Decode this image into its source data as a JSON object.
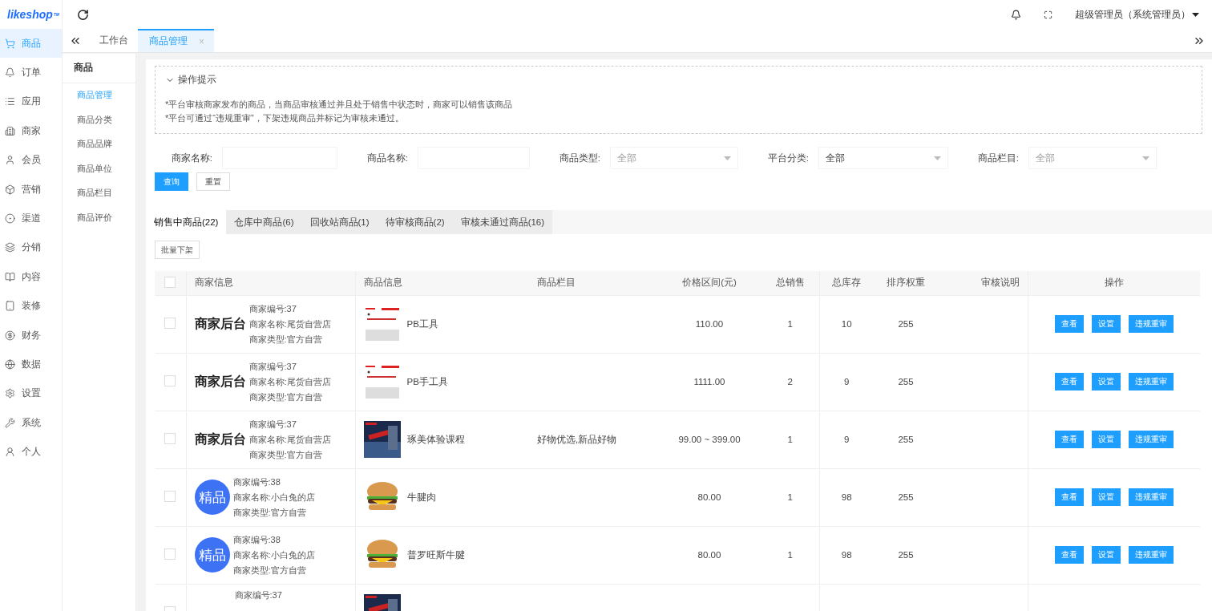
{
  "logo": {
    "text": "likeshop",
    "mark": "TM"
  },
  "nav": [
    {
      "label": "商品",
      "selected": true
    },
    {
      "label": "订单",
      "selected": false
    },
    {
      "label": "应用",
      "selected": false
    },
    {
      "label": "商家",
      "selected": false
    },
    {
      "label": "会员",
      "selected": false
    },
    {
      "label": "营销",
      "selected": false
    },
    {
      "label": "渠道",
      "selected": false
    },
    {
      "label": "分销",
      "selected": false
    },
    {
      "label": "内容",
      "selected": false
    },
    {
      "label": "装修",
      "selected": false
    },
    {
      "label": "财务",
      "selected": false
    },
    {
      "label": "数据",
      "selected": false
    },
    {
      "label": "设置",
      "selected": false
    },
    {
      "label": "系统",
      "selected": false
    },
    {
      "label": "个人",
      "selected": false
    }
  ],
  "header": {
    "user": "超级管理员（系统管理员）"
  },
  "page_tabs": [
    {
      "label": "工作台",
      "selected": false,
      "closable": false
    },
    {
      "label": "商品管理",
      "selected": true,
      "closable": true
    }
  ],
  "page_tabs_close": "×",
  "submenu": {
    "title": "商品",
    "items": [
      {
        "label": "商品管理",
        "selected": true
      },
      {
        "label": "商品分类",
        "selected": false
      },
      {
        "label": "商品品牌",
        "selected": false
      },
      {
        "label": "商品单位",
        "selected": false
      },
      {
        "label": "商品栏目",
        "selected": false
      },
      {
        "label": "商品评价",
        "selected": false
      }
    ]
  },
  "hint": {
    "title": "操作提示",
    "expanded": true,
    "lines": [
      "*平台审核商家发布的商品，当商品审核通过并且处于销售中状态时，商家可以销售该商品",
      "*平台可通过“违规重审”，下架违规商品并标记为审核未通过。"
    ]
  },
  "filters": [
    {
      "label": "商家名称:",
      "kind": "input"
    },
    {
      "label": "商品名称:",
      "kind": "input"
    },
    {
      "label": "商品类型:",
      "kind": "select",
      "placeholder": "全部"
    },
    {
      "label": "平台分类:",
      "kind": "select",
      "value": "全部"
    },
    {
      "label": "商品栏目:",
      "kind": "select",
      "placeholder": "全部"
    }
  ],
  "filter_buttons": [
    {
      "label": "查询",
      "primary": true
    },
    {
      "label": "重置",
      "primary": false
    }
  ],
  "status_tabs": [
    {
      "label": "销售中商品(22)",
      "selected": true
    },
    {
      "label": "仓库中商品(6)",
      "selected": false
    },
    {
      "label": "回收站商品(1)",
      "selected": false
    },
    {
      "label": "待审核商品(2)",
      "selected": false
    },
    {
      "label": "审核未通过商品(16)",
      "selected": false
    }
  ],
  "batch_button": "批量下架",
  "table": {
    "all_checked": false,
    "columns": [
      "商家信息",
      "商品信息",
      "商品栏目",
      "价格区间(元)",
      "总销售",
      "总库存",
      "排序权重",
      "审核说明",
      "操作"
    ],
    "rows": [
      {
        "checked": false,
        "logo": {
          "kind": "text",
          "text": "商家后台"
        },
        "merchant": [
          "商家编号:37",
          "商家名称:尾货自营店",
          "商家类型:官方自营"
        ],
        "product": "PB工具",
        "price": "110.00",
        "sales": "1",
        "stock": "10",
        "weight": "255",
        "actions": [
          "查看",
          "设置",
          "违规重审"
        ]
      },
      {
        "checked": false,
        "logo": {
          "kind": "text",
          "text": "商家后台"
        },
        "merchant": [
          "商家编号:37",
          "商家名称:尾货自营店",
          "商家类型:官方自营"
        ],
        "product": "PB手工具",
        "price": "1111.00",
        "sales": "2",
        "stock": "9",
        "weight": "255",
        "actions": [
          "查看",
          "设置",
          "违规重审"
        ]
      },
      {
        "checked": false,
        "logo": {
          "kind": "text",
          "text": "商家后台"
        },
        "merchant": [
          "商家编号:37",
          "商家名称:尾货自营店",
          "商家类型:官方自营"
        ],
        "product": "琢美体验课程",
        "category": "好物优选,新品好物",
        "price": "99.00 ~ 399.00",
        "sales": "1",
        "stock": "9",
        "weight": "255",
        "actions": [
          "查看",
          "设置",
          "违规重审"
        ]
      },
      {
        "checked": false,
        "logo": {
          "kind": "badge",
          "text": "精品"
        },
        "merchant": [
          "商家编号:38",
          "商家名称:小白兔的店",
          "商家类型:官方自营"
        ],
        "product": "牛腱肉",
        "price": "80.00",
        "sales": "1",
        "stock": "98",
        "weight": "255",
        "actions": [
          "查看",
          "设置",
          "违规重审"
        ]
      },
      {
        "checked": false,
        "logo": {
          "kind": "badge",
          "text": "精品"
        },
        "merchant": [
          "商家编号:38",
          "商家名称:小白兔的店",
          "商家类型:官方自营"
        ],
        "product": "普罗旺斯牛腱",
        "price": "80.00",
        "sales": "1",
        "stock": "98",
        "weight": "255",
        "actions": [
          "查看",
          "设置",
          "违规重审"
        ]
      },
      {
        "checked": false,
        "merchant": [
          "商家编号:37"
        ],
        "actions": []
      }
    ]
  }
}
